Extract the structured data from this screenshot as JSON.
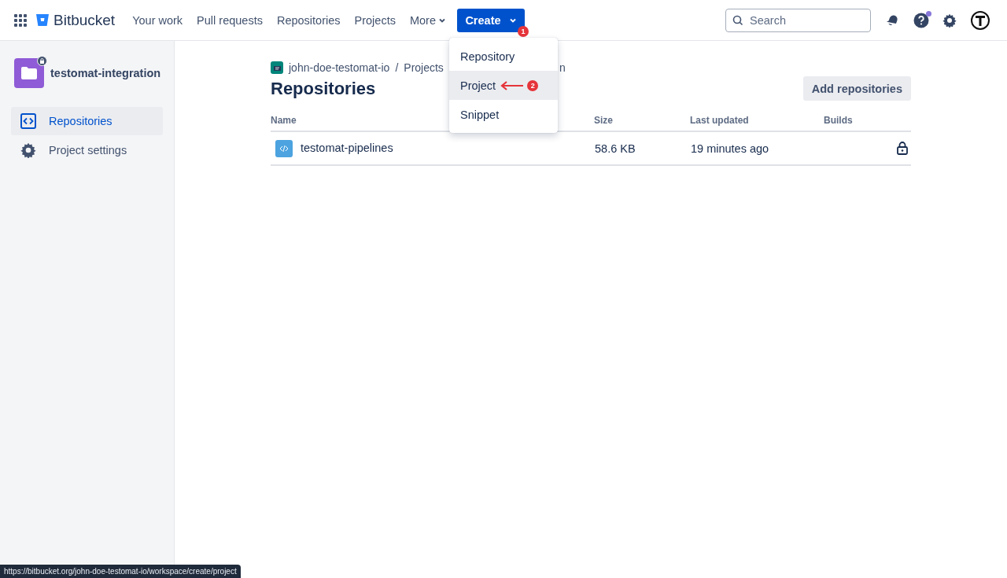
{
  "header": {
    "product": "Bitbucket",
    "nav": [
      {
        "label": "Your work",
        "kind": "link"
      },
      {
        "label": "Pull requests",
        "kind": "link"
      },
      {
        "label": "Repositories",
        "kind": "link"
      },
      {
        "label": "Projects",
        "kind": "link"
      },
      {
        "label": "More",
        "kind": "dropdown"
      }
    ],
    "create": {
      "label": "Create",
      "badge": "1"
    },
    "search": {
      "placeholder": "Search"
    },
    "help_dot": true
  },
  "create_menu": {
    "items": [
      {
        "label": "Repository",
        "selected": false
      },
      {
        "label": "Project",
        "selected": true,
        "badge": "2"
      },
      {
        "label": "Snippet",
        "selected": false
      }
    ]
  },
  "sidebar": {
    "project": "testomat-integration",
    "items": [
      {
        "label": "Repositories",
        "selected": true,
        "kind": "repos"
      },
      {
        "label": "Project settings",
        "selected": false,
        "kind": "settings"
      }
    ]
  },
  "breadcrumbs": [
    {
      "kind": "link",
      "label": "john-doe-testomat-io"
    },
    {
      "kind": "separator",
      "label": "/"
    },
    {
      "kind": "link",
      "label": "Projects"
    },
    {
      "kind": "hidden",
      "label": "n"
    }
  ],
  "page": {
    "title": "Repositories",
    "action": "Add repositories"
  },
  "table": {
    "columns": [
      "Name",
      "Size",
      "Last updated",
      "Builds"
    ],
    "rows": [
      {
        "name": "testomat-pipelines",
        "size": "58.6 KB",
        "updated": "19 minutes ago",
        "private": true
      }
    ]
  },
  "status_url": "https://bitbucket.org/john-doe-testomat-io/workspace/create/project"
}
